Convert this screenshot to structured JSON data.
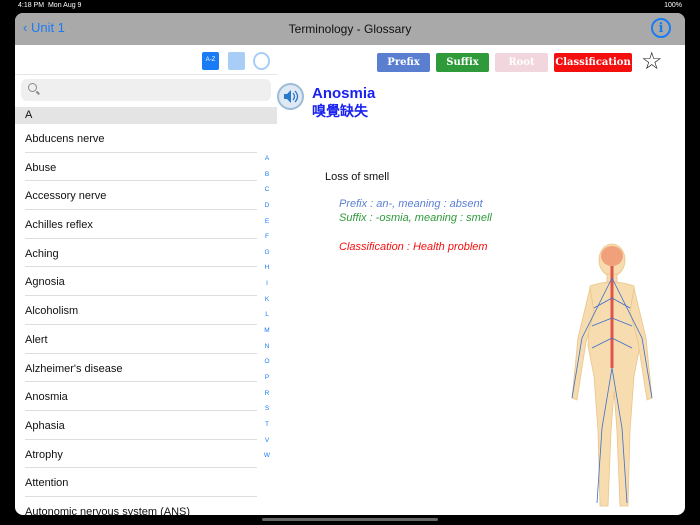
{
  "status": {
    "time": "4:18 PM",
    "date": "Mon Aug 9",
    "battery": "100%"
  },
  "nav": {
    "back": "Unit 1",
    "title": "Terminology - Glossary"
  },
  "toolbar": {
    "az": "A-Z"
  },
  "buttons": {
    "prefix": "Prefix",
    "suffix": "Suffix",
    "root": "Root",
    "classification": "Classification"
  },
  "colors": {
    "prefix": "#5a7fd1",
    "suffix": "#2e9a3a",
    "root": "#f2d6de",
    "classification": "#f40f0f",
    "accent": "#1a7cf5"
  },
  "list": {
    "section": "A",
    "items": [
      "Abducens nerve",
      "Abuse",
      "Accessory nerve",
      "Achilles reflex",
      "Aching",
      "Agnosia",
      "Alcoholism",
      "Alert",
      "Alzheimer's disease",
      "Anosmia",
      "Aphasia",
      "Atrophy",
      "Attention",
      "Autonomic nervous system (ANS)"
    ]
  },
  "index": [
    "A",
    "B",
    "C",
    "D",
    "E",
    "F",
    "G",
    "H",
    "I",
    "K",
    "L",
    "M",
    "N",
    "O",
    "P",
    "R",
    "S",
    "T",
    "V",
    "W"
  ],
  "detail": {
    "term": "Anosmia",
    "chinese": "嗅覺缺失",
    "definition": "Loss of smell",
    "prefix": "Prefix : an-, meaning : absent",
    "suffix": "Suffix : -osmia, meaning : smell",
    "classification": "Classification : Health problem"
  }
}
